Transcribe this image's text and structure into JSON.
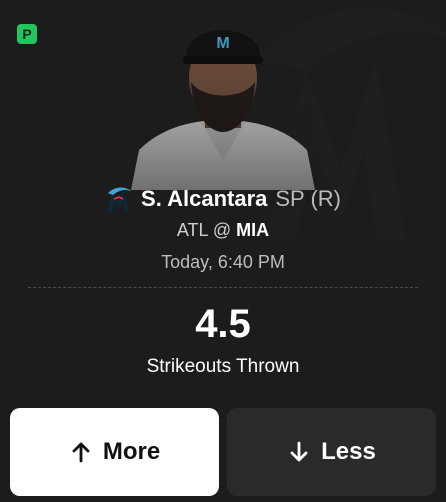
{
  "badge": {
    "text": "P",
    "color": "#22c55e"
  },
  "player": {
    "name": "S. Alcantara",
    "position": "SP (R)"
  },
  "game": {
    "away": "ATL",
    "separator": "@",
    "home": "MIA",
    "time": "Today, 6:40 PM"
  },
  "prop": {
    "line": "4.5",
    "stat": "Strikeouts Thrown"
  },
  "buttons": {
    "more_label": "More",
    "less_label": "Less"
  },
  "icons": {
    "team_logo": "marlins-logo-icon",
    "more": "arrow-up-icon",
    "less": "arrow-down-icon"
  }
}
